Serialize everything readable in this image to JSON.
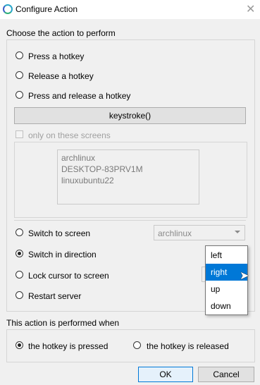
{
  "window": {
    "title": "Configure Action",
    "close_glyph": "✕",
    "app_icon": "synergy-ring-icon"
  },
  "action_group": {
    "label": "Choose the action to perform",
    "options": [
      {
        "label": "Press a hotkey",
        "checked": false
      },
      {
        "label": "Release a hotkey",
        "checked": false
      },
      {
        "label": "Press and release a hotkey",
        "checked": false
      }
    ],
    "keystroke_button": "keystroke()",
    "only_screens_label": "only on these screens",
    "screens": [
      "archlinux",
      "DESKTOP-83PRV1M",
      "linuxubuntu22"
    ],
    "lower_options": [
      {
        "label": "Switch to screen",
        "checked": false
      },
      {
        "label": "Switch in direction",
        "checked": true
      },
      {
        "label": "Lock cursor to screen",
        "checked": false
      },
      {
        "label": "Restart server",
        "checked": false
      }
    ],
    "switch_screen_value": "archlinux"
  },
  "direction_dropdown": {
    "options": [
      "left",
      "right",
      "up",
      "down"
    ],
    "highlighted": "right"
  },
  "trigger_group": {
    "label": "This action is performed when",
    "options": [
      {
        "label": "the hotkey is pressed",
        "checked": true
      },
      {
        "label": "the hotkey is released",
        "checked": false
      }
    ]
  },
  "footer": {
    "ok_label": "OK",
    "cancel_label": "Cancel"
  },
  "colors": {
    "accent": "#0078d7",
    "frame_border": "#d5d5d5"
  }
}
